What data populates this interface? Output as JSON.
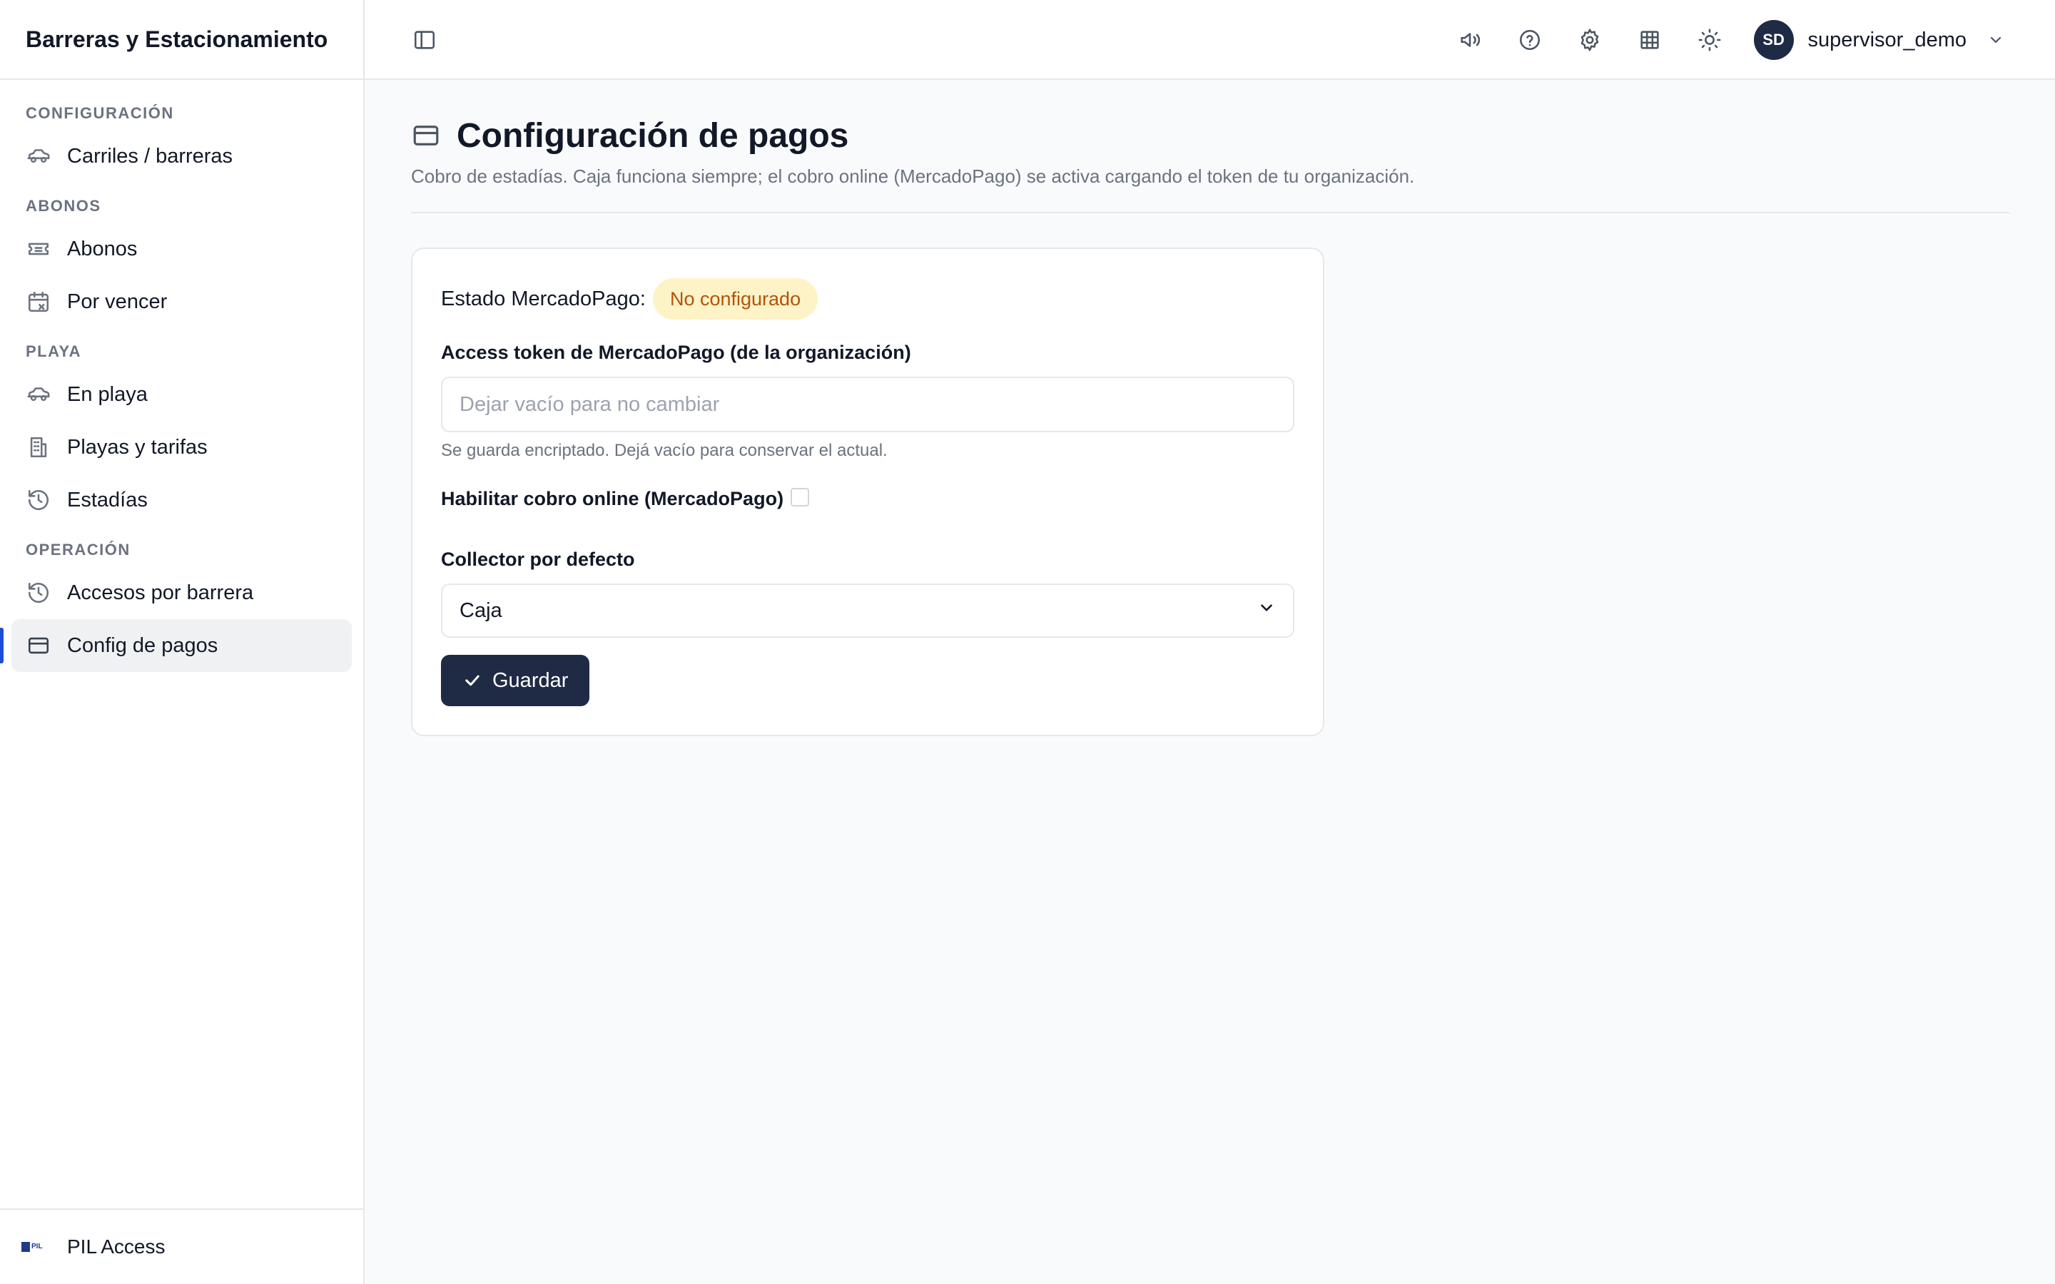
{
  "app": {
    "title": "Barreras y Estacionamiento"
  },
  "sidebar": {
    "sections": [
      {
        "title": "CONFIGURACIÓN",
        "items": [
          {
            "label": "Carriles / barreras",
            "icon": "car-icon"
          }
        ]
      },
      {
        "title": "ABONOS",
        "items": [
          {
            "label": "Abonos",
            "icon": "ticket-icon"
          },
          {
            "label": "Por vencer",
            "icon": "calendar-x-icon"
          }
        ]
      },
      {
        "title": "PLAYA",
        "items": [
          {
            "label": "En playa",
            "icon": "car-icon"
          },
          {
            "label": "Playas y tarifas",
            "icon": "building-icon"
          },
          {
            "label": "Estadías",
            "icon": "history-icon"
          }
        ]
      },
      {
        "title": "OPERACIÓN",
        "items": [
          {
            "label": "Accesos por barrera",
            "icon": "history-icon"
          },
          {
            "label": "Config de pagos",
            "icon": "credit-card-icon",
            "active": true
          }
        ]
      }
    ],
    "footer": {
      "label": "PIL Access",
      "logo_text": "PIL"
    }
  },
  "topbar": {
    "icons": [
      "sidebar-toggle-icon",
      "megaphone-icon",
      "help-icon",
      "settings-icon",
      "grid-icon",
      "sun-icon"
    ],
    "user": {
      "initials": "SD",
      "name": "supervisor_demo"
    }
  },
  "page": {
    "title": "Configuración de pagos",
    "subtitle": "Cobro de estadías. Caja funciona siempre; el cobro online (MercadoPago) se activa cargando el token de tu organización."
  },
  "form": {
    "status_label": "Estado MercadoPago:",
    "status_badge": "No configurado",
    "token_label": "Access token de MercadoPago (de la organización)",
    "token_value": "",
    "token_placeholder": "Dejar vacío para no cambiar",
    "token_help": "Se guarda encriptado. Dejá vacío para conservar el actual.",
    "online_label": "Habilitar cobro online (MercadoPago)",
    "online_enabled": false,
    "collector_label": "Collector por defecto",
    "collector_value": "Caja",
    "save_label": "Guardar"
  },
  "colors": {
    "accent": "#1f2a44",
    "active_indicator": "#1d4ed8",
    "badge_bg": "#fef3c7",
    "badge_text": "#b45309"
  }
}
